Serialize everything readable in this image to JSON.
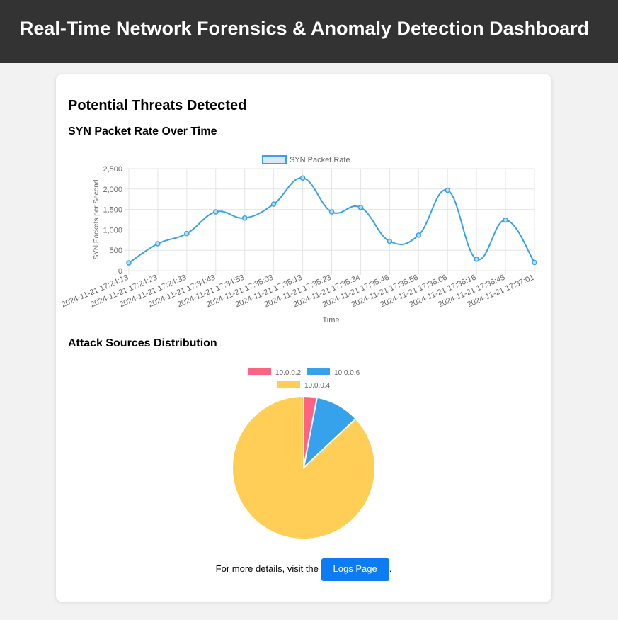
{
  "header": {
    "title": "Real-Time Network Forensics & Anomaly Detection Dashboard"
  },
  "main": {
    "section_title": "Potential Threats Detected",
    "syn_chart_title": "SYN Packet Rate Over Time",
    "pie_chart_title": "Attack Sources Distribution",
    "footer_text": "For more details, visit the",
    "logs_button_label": "Logs Page",
    "footer_suffix": "."
  },
  "chart_data": [
    {
      "type": "line",
      "legend": [
        "SYN Packet Rate"
      ],
      "legend_position": "top",
      "xlabel": "Time",
      "ylabel": "SYN Packets per Second",
      "ylim": [
        0,
        2500
      ],
      "yticks": [
        "0",
        "500",
        "1,000",
        "1,500",
        "2,000",
        "2,500"
      ],
      "grid": true,
      "x": [
        "2024-11-21 17:24:13",
        "2024-11-21 17:24:23",
        "2024-11-21 17:24:33",
        "2024-11-21 17:34:43",
        "2024-11-21 17:34:53",
        "2024-11-21 17:35:03",
        "2024-11-21 17:35:13",
        "2024-11-21 17:35:23",
        "2024-11-21 17:35:34",
        "2024-11-21 17:35:46",
        "2024-11-21 17:35:56",
        "2024-11-21 17:36:06",
        "2024-11-21 17:36:16",
        "2024-11-21 17:36:45",
        "2024-11-21 17:37:01"
      ],
      "series": [
        {
          "name": "SYN Packet Rate",
          "color": "#36a2eb",
          "values": [
            190,
            660,
            910,
            1440,
            1290,
            1630,
            2270,
            1440,
            1550,
            720,
            870,
            1970,
            280,
            1240,
            200
          ]
        }
      ]
    },
    {
      "type": "pie",
      "legend_position": "top",
      "labels": [
        "10.0.0.2",
        "10.0.0.6",
        "10.0.0.4"
      ],
      "values": [
        3,
        10,
        87
      ],
      "colors": [
        "#ff6384",
        "#36a2eb",
        "#ffce56"
      ]
    }
  ]
}
